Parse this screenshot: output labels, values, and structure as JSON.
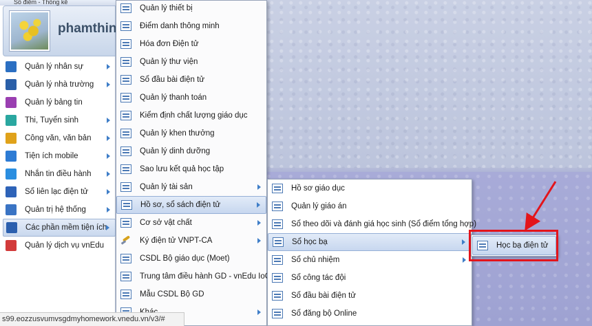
{
  "top_strip_text": "Số điểm -         Thống kê",
  "user": {
    "name": "phamthin"
  },
  "nav": [
    {
      "label": "Quản lý nhân sự",
      "icon": "staff-icon",
      "color": "#2b6fc2",
      "arrow": true
    },
    {
      "label": "Quản lý nhà trường",
      "icon": "school-icon",
      "color": "#2a5fa8",
      "arrow": true
    },
    {
      "label": "Quản lý bảng tin",
      "icon": "news-icon",
      "color": "#9a3fb1",
      "arrow": false
    },
    {
      "label": "Thi, Tuyển sinh",
      "icon": "exam-icon",
      "color": "#2aa7a0",
      "arrow": true
    },
    {
      "label": "Công văn, văn bản",
      "icon": "document-icon",
      "color": "#e0a21a",
      "arrow": true
    },
    {
      "label": "Tiện ích mobile",
      "icon": "mobile-icon",
      "color": "#2d7bd4",
      "arrow": true
    },
    {
      "label": "Nhắn tin điều hành",
      "icon": "message-icon",
      "color": "#2a8ee0",
      "arrow": true
    },
    {
      "label": "Sổ liên lạc điện tử",
      "icon": "contact-book-icon",
      "color": "#2e63b8",
      "arrow": true
    },
    {
      "label": "Quản trị hệ thống",
      "icon": "gear-icon",
      "color": "#3a74c4",
      "arrow": true
    },
    {
      "label": "Các phần mềm tiện ích",
      "icon": "apps-grid-icon",
      "color": "#2b5fae",
      "arrow": true,
      "active": true
    },
    {
      "label": "Quản lý dịch vụ vnEdu",
      "icon": "service-icon",
      "color": "#d23a3a",
      "arrow": false
    }
  ],
  "submenu1": [
    {
      "label": "Quản lý thiết bị",
      "arrow": false
    },
    {
      "label": "Điểm danh thông minh",
      "arrow": false
    },
    {
      "label": "Hóa đơn Điện tử",
      "arrow": false
    },
    {
      "label": "Quản lý thư viện",
      "arrow": false
    },
    {
      "label": "Sổ đầu bài điện tử",
      "arrow": false
    },
    {
      "label": "Quản lý thanh toán",
      "arrow": false
    },
    {
      "label": "Kiểm định chất lượng giáo dục",
      "arrow": false
    },
    {
      "label": "Quản lý khen thưởng",
      "arrow": false
    },
    {
      "label": "Quản lý dinh dưỡng",
      "arrow": false
    },
    {
      "label": "Sao lưu kết quả học tập",
      "arrow": false
    },
    {
      "label": "Quản lý tài sản",
      "arrow": true
    },
    {
      "label": "Hồ sơ, sổ sách điện tử",
      "arrow": true,
      "active": true
    },
    {
      "label": "Cơ sở vật chất",
      "arrow": true
    },
    {
      "label": "Ký điện tử VNPT-CA",
      "arrow": true,
      "icon": "pen"
    },
    {
      "label": "CSDL Bộ giáo dục (Moet)",
      "arrow": false
    },
    {
      "label": "Trung tâm điều hành GD - vnEdu IoC",
      "arrow": false
    },
    {
      "label": "Mẫu CSDL Bộ GD",
      "arrow": false
    },
    {
      "label": "Khác",
      "arrow": true
    }
  ],
  "submenu2": [
    {
      "label": "Hồ sơ giáo dục",
      "arrow": false
    },
    {
      "label": "Quản lý giáo án",
      "arrow": false
    },
    {
      "label": "Sổ theo dõi và đánh giá học sinh (Sổ điểm tổng hợp)",
      "arrow": false
    },
    {
      "label": "Sổ học bạ",
      "arrow": true,
      "active": true
    },
    {
      "label": "Sổ chủ nhiệm",
      "arrow": true
    },
    {
      "label": "Sổ công tác đội",
      "arrow": false
    },
    {
      "label": "Sổ đầu bài điện tử",
      "arrow": false
    },
    {
      "label": "Sổ đăng bộ Online",
      "arrow": false
    }
  ],
  "submenu3": [
    {
      "label": "Học bạ điện tử",
      "active": true
    }
  ],
  "statusbar": {
    "url": "s99.eozzusvumvsgdmyhomework.vnedu.vn/v3/#"
  },
  "annotation": {
    "color": "#e3141b"
  }
}
